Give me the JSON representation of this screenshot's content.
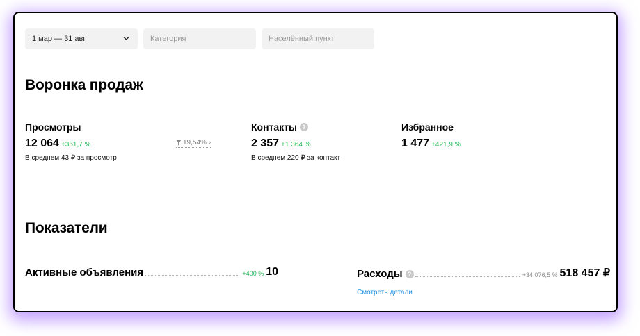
{
  "filters": {
    "period_value": "1 мар — 31 авг",
    "category_placeholder": "Категория",
    "city_placeholder": "Населённый пункт"
  },
  "funnel": {
    "title": "Воронка продаж",
    "views": {
      "label": "Просмотры",
      "value": "12 064",
      "delta": "+361,7 %",
      "sub": "В среднем 43 ₽ за просмотр"
    },
    "conversion": {
      "value": "19,54%",
      "icon": "funnel-icon",
      "arrow": "›"
    },
    "contacts": {
      "label": "Контакты",
      "value": "2 357",
      "delta": "+1 364 %",
      "sub": "В среднем 220 ₽ за контакт",
      "help_icon": "?"
    },
    "favorites": {
      "label": "Избранное",
      "value": "1 477",
      "delta": "+421,9 %"
    }
  },
  "metrics": {
    "title": "Показатели",
    "active_ads": {
      "label": "Активные объявления",
      "delta": "+400 %",
      "value": "10"
    },
    "expenses": {
      "label": "Расходы",
      "help_icon": "?",
      "delta": "+34 076,5 %",
      "value": "518 457 ₽",
      "details_link": "Смотреть детали"
    }
  },
  "colors": {
    "positive": "#1db954",
    "link": "#1a8fe0",
    "shadow": "#9659ff"
  }
}
